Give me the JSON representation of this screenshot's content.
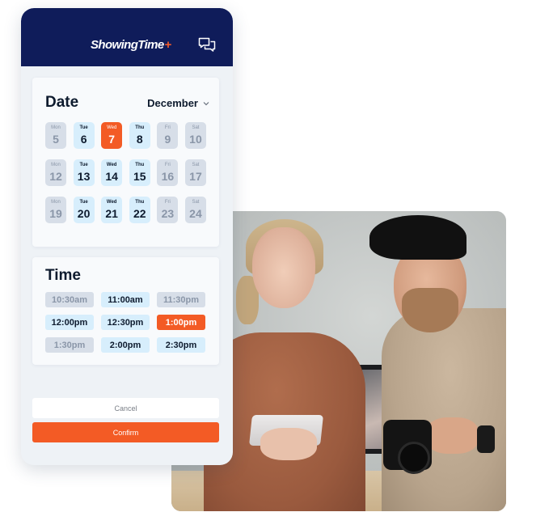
{
  "app": {
    "logo_text": "ShowingTime",
    "logo_plus": "+",
    "header_icon": "chat-bubbles-icon"
  },
  "colors": {
    "header_bg": "#0f1c5a",
    "accent": "#f35b25",
    "available_bg": "#d7eefc",
    "unavailable_bg": "#d7dee8",
    "text_dark": "#0e1b2e"
  },
  "date_section": {
    "title": "Date",
    "month": "December",
    "selected_date": "Wed 7",
    "days": [
      {
        "dow": "Mon",
        "num": "5",
        "state": "unavailable"
      },
      {
        "dow": "Tue",
        "num": "6",
        "state": "available"
      },
      {
        "dow": "Wed",
        "num": "7",
        "state": "selected"
      },
      {
        "dow": "Thu",
        "num": "8",
        "state": "available"
      },
      {
        "dow": "Fri",
        "num": "9",
        "state": "unavailable"
      },
      {
        "dow": "Sat",
        "num": "10",
        "state": "unavailable"
      },
      {
        "dow": "Mon",
        "num": "12",
        "state": "unavailable"
      },
      {
        "dow": "Tue",
        "num": "13",
        "state": "available"
      },
      {
        "dow": "Wed",
        "num": "14",
        "state": "available"
      },
      {
        "dow": "Thu",
        "num": "15",
        "state": "available"
      },
      {
        "dow": "Fri",
        "num": "16",
        "state": "unavailable"
      },
      {
        "dow": "Sat",
        "num": "17",
        "state": "unavailable"
      },
      {
        "dow": "Mon",
        "num": "19",
        "state": "unavailable"
      },
      {
        "dow": "Tue",
        "num": "20",
        "state": "available"
      },
      {
        "dow": "Wed",
        "num": "21",
        "state": "available"
      },
      {
        "dow": "Thu",
        "num": "22",
        "state": "available"
      },
      {
        "dow": "Fri",
        "num": "23",
        "state": "unavailable"
      },
      {
        "dow": "Sat",
        "num": "24",
        "state": "unavailable"
      }
    ]
  },
  "time_section": {
    "title": "Time",
    "selected_time": "1:00pm",
    "slots": [
      {
        "label": "10:30am",
        "state": "unavailable"
      },
      {
        "label": "11:00am",
        "state": "available"
      },
      {
        "label": "11:30pm",
        "state": "unavailable"
      },
      {
        "label": "12:00pm",
        "state": "available"
      },
      {
        "label": "12:30pm",
        "state": "available"
      },
      {
        "label": "1:00pm",
        "state": "selected"
      },
      {
        "label": "1:30pm",
        "state": "unavailable"
      },
      {
        "label": "2:00pm",
        "state": "available"
      },
      {
        "label": "2:30pm",
        "state": "available"
      }
    ]
  },
  "actions": {
    "cancel_label": "Cancel",
    "confirm_label": "Confirm"
  },
  "photo": {
    "description": "Two people — a woman holding a tablet and a bearded man in a black cap holding a camera"
  }
}
